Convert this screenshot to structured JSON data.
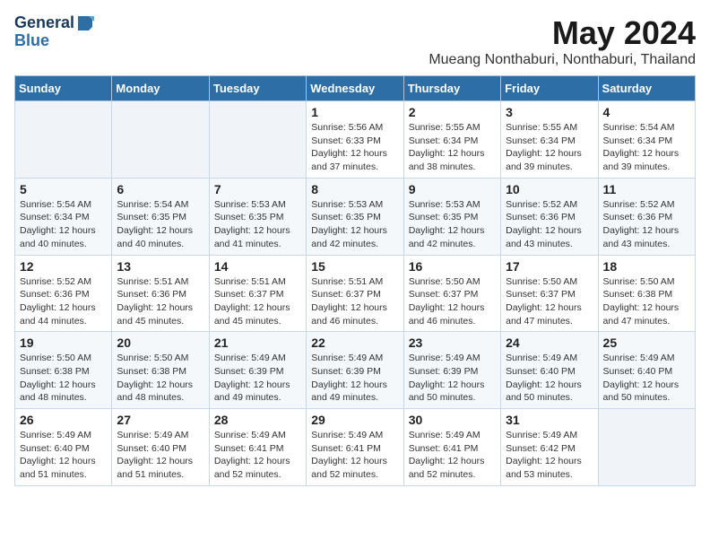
{
  "logo": {
    "general": "General",
    "blue": "Blue"
  },
  "title": "May 2024",
  "subtitle": "Mueang Nonthaburi, Nonthaburi, Thailand",
  "weekdays": [
    "Sunday",
    "Monday",
    "Tuesday",
    "Wednesday",
    "Thursday",
    "Friday",
    "Saturday"
  ],
  "weeks": [
    [
      {
        "day": "",
        "info": ""
      },
      {
        "day": "",
        "info": ""
      },
      {
        "day": "",
        "info": ""
      },
      {
        "day": "1",
        "info": "Sunrise: 5:56 AM\nSunset: 6:33 PM\nDaylight: 12 hours\nand 37 minutes."
      },
      {
        "day": "2",
        "info": "Sunrise: 5:55 AM\nSunset: 6:34 PM\nDaylight: 12 hours\nand 38 minutes."
      },
      {
        "day": "3",
        "info": "Sunrise: 5:55 AM\nSunset: 6:34 PM\nDaylight: 12 hours\nand 39 minutes."
      },
      {
        "day": "4",
        "info": "Sunrise: 5:54 AM\nSunset: 6:34 PM\nDaylight: 12 hours\nand 39 minutes."
      }
    ],
    [
      {
        "day": "5",
        "info": "Sunrise: 5:54 AM\nSunset: 6:34 PM\nDaylight: 12 hours\nand 40 minutes."
      },
      {
        "day": "6",
        "info": "Sunrise: 5:54 AM\nSunset: 6:35 PM\nDaylight: 12 hours\nand 40 minutes."
      },
      {
        "day": "7",
        "info": "Sunrise: 5:53 AM\nSunset: 6:35 PM\nDaylight: 12 hours\nand 41 minutes."
      },
      {
        "day": "8",
        "info": "Sunrise: 5:53 AM\nSunset: 6:35 PM\nDaylight: 12 hours\nand 42 minutes."
      },
      {
        "day": "9",
        "info": "Sunrise: 5:53 AM\nSunset: 6:35 PM\nDaylight: 12 hours\nand 42 minutes."
      },
      {
        "day": "10",
        "info": "Sunrise: 5:52 AM\nSunset: 6:36 PM\nDaylight: 12 hours\nand 43 minutes."
      },
      {
        "day": "11",
        "info": "Sunrise: 5:52 AM\nSunset: 6:36 PM\nDaylight: 12 hours\nand 43 minutes."
      }
    ],
    [
      {
        "day": "12",
        "info": "Sunrise: 5:52 AM\nSunset: 6:36 PM\nDaylight: 12 hours\nand 44 minutes."
      },
      {
        "day": "13",
        "info": "Sunrise: 5:51 AM\nSunset: 6:36 PM\nDaylight: 12 hours\nand 45 minutes."
      },
      {
        "day": "14",
        "info": "Sunrise: 5:51 AM\nSunset: 6:37 PM\nDaylight: 12 hours\nand 45 minutes."
      },
      {
        "day": "15",
        "info": "Sunrise: 5:51 AM\nSunset: 6:37 PM\nDaylight: 12 hours\nand 46 minutes."
      },
      {
        "day": "16",
        "info": "Sunrise: 5:50 AM\nSunset: 6:37 PM\nDaylight: 12 hours\nand 46 minutes."
      },
      {
        "day": "17",
        "info": "Sunrise: 5:50 AM\nSunset: 6:37 PM\nDaylight: 12 hours\nand 47 minutes."
      },
      {
        "day": "18",
        "info": "Sunrise: 5:50 AM\nSunset: 6:38 PM\nDaylight: 12 hours\nand 47 minutes."
      }
    ],
    [
      {
        "day": "19",
        "info": "Sunrise: 5:50 AM\nSunset: 6:38 PM\nDaylight: 12 hours\nand 48 minutes."
      },
      {
        "day": "20",
        "info": "Sunrise: 5:50 AM\nSunset: 6:38 PM\nDaylight: 12 hours\nand 48 minutes."
      },
      {
        "day": "21",
        "info": "Sunrise: 5:49 AM\nSunset: 6:39 PM\nDaylight: 12 hours\nand 49 minutes."
      },
      {
        "day": "22",
        "info": "Sunrise: 5:49 AM\nSunset: 6:39 PM\nDaylight: 12 hours\nand 49 minutes."
      },
      {
        "day": "23",
        "info": "Sunrise: 5:49 AM\nSunset: 6:39 PM\nDaylight: 12 hours\nand 50 minutes."
      },
      {
        "day": "24",
        "info": "Sunrise: 5:49 AM\nSunset: 6:40 PM\nDaylight: 12 hours\nand 50 minutes."
      },
      {
        "day": "25",
        "info": "Sunrise: 5:49 AM\nSunset: 6:40 PM\nDaylight: 12 hours\nand 50 minutes."
      }
    ],
    [
      {
        "day": "26",
        "info": "Sunrise: 5:49 AM\nSunset: 6:40 PM\nDaylight: 12 hours\nand 51 minutes."
      },
      {
        "day": "27",
        "info": "Sunrise: 5:49 AM\nSunset: 6:40 PM\nDaylight: 12 hours\nand 51 minutes."
      },
      {
        "day": "28",
        "info": "Sunrise: 5:49 AM\nSunset: 6:41 PM\nDaylight: 12 hours\nand 52 minutes."
      },
      {
        "day": "29",
        "info": "Sunrise: 5:49 AM\nSunset: 6:41 PM\nDaylight: 12 hours\nand 52 minutes."
      },
      {
        "day": "30",
        "info": "Sunrise: 5:49 AM\nSunset: 6:41 PM\nDaylight: 12 hours\nand 52 minutes."
      },
      {
        "day": "31",
        "info": "Sunrise: 5:49 AM\nSunset: 6:42 PM\nDaylight: 12 hours\nand 53 minutes."
      },
      {
        "day": "",
        "info": ""
      }
    ]
  ]
}
